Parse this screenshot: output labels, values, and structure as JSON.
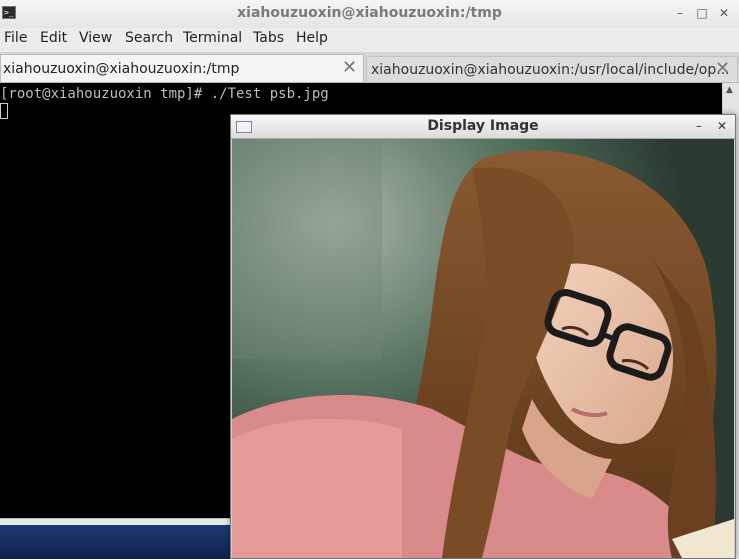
{
  "window": {
    "title": "xiahouzuoxin@xiahouzuoxin:/tmp",
    "minimize_glyph": "–",
    "maximize_glyph": "□",
    "close_glyph": "✕"
  },
  "menu": [
    "File",
    "Edit",
    "View",
    "Search",
    "Terminal",
    "Tabs",
    "Help"
  ],
  "tabs": [
    {
      "label": "xiahouzuoxin@xiahouzuoxin:/tmp",
      "active": true,
      "close_glyph": "✕"
    },
    {
      "label": "xiahouzuoxin@xiahouzuoxin:/usr/local/include/op...",
      "active": false,
      "close_glyph": "✕"
    }
  ],
  "terminal": {
    "prompt_line": "[root@xiahouzuoxin tmp]# ./Test psb.jpg"
  },
  "image_window": {
    "title": "Display Image",
    "minimize_glyph": "–",
    "close_glyph": "✕",
    "image_file": "psb.jpg"
  },
  "colors": {
    "terminal_bg": "#000000",
    "terminal_fg": "#bdbdbd",
    "desktop_bg": "#1c3a73"
  },
  "icons": {
    "app": "terminal-icon",
    "scroll_up": "up-arrow-icon"
  }
}
